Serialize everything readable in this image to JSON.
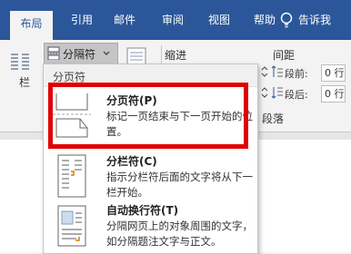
{
  "tabs": [
    {
      "label": "布局",
      "active": true
    },
    {
      "label": "引用"
    },
    {
      "label": "邮件"
    },
    {
      "label": "审阅"
    },
    {
      "label": "视图"
    },
    {
      "label": "帮助"
    },
    {
      "label": "告诉我"
    }
  ],
  "ribbon": {
    "column_label": "栏",
    "breaks_button_label": "分隔符",
    "indent_label": "缩进",
    "spacing_label": "间距",
    "before_label": "段前:",
    "before_value": "0 行",
    "after_label": "段后:",
    "after_value": "0 行",
    "paragraph_group_label": "段落"
  },
  "menu": {
    "header": "分页符",
    "items": [
      {
        "title": "分页符(P)",
        "desc": "标记一页结束与下一页开始的位置。",
        "icon": "page-break-icon"
      },
      {
        "title": "分栏符(C)",
        "desc": "指示分栏符后面的文字将从下一栏开始。",
        "icon": "column-break-icon"
      },
      {
        "title": "自动换行符(T)",
        "desc": "分隔网页上的对象周围的文字，如分隔题注文字与正文。",
        "icon": "text-wrapping-icon"
      }
    ]
  },
  "colors": {
    "accent": "#2b579a",
    "highlight": "#e00000"
  }
}
